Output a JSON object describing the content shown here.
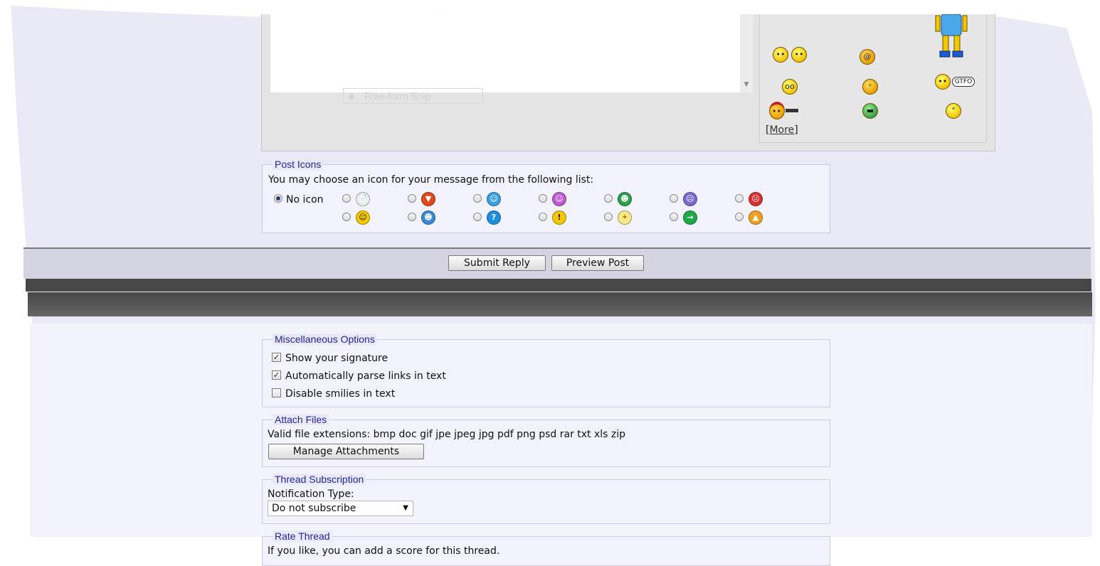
{
  "editor": {
    "snip_ghost_label": "Free-form Snip",
    "more_link": "More"
  },
  "smilies": [
    "tweedledum-icon",
    "dizzy-icon",
    "laughing-duo-icon",
    "eek-icon",
    "devil-icon",
    "gtfo-icon",
    "pirate-gun-icon",
    "grin-icon",
    "shocked-icon"
  ],
  "post_icons": {
    "legend": "Post Icons",
    "prompt": "You may choose an icon for your message from the following list:",
    "no_icon_label": "No icon",
    "row1": [
      {
        "name": "post-icon-document",
        "glyph": "📄",
        "color": "#f0f0f0",
        "fg": "#333"
      },
      {
        "name": "post-icon-thumbs-down",
        "glyph": "▼",
        "color": "#e0471a",
        "fg": "#fff"
      },
      {
        "name": "post-icon-wink",
        "glyph": "☺",
        "color": "#3aa0e0",
        "fg": "#fff"
      },
      {
        "name": "post-icon-tongue",
        "glyph": "☺",
        "color": "#c05ad0",
        "fg": "#fff"
      },
      {
        "name": "post-icon-big-grin",
        "glyph": "☻",
        "color": "#2fa04a",
        "fg": "#fff"
      },
      {
        "name": "post-icon-frown",
        "glyph": "☹",
        "color": "#7a6ad0",
        "fg": "#fff"
      },
      {
        "name": "post-icon-mad",
        "glyph": "☹",
        "color": "#d83030",
        "fg": "#fff"
      }
    ],
    "row2": [
      {
        "name": "post-icon-smile",
        "glyph": "☺",
        "color": "#f3c800",
        "fg": "#222"
      },
      {
        "name": "post-icon-cool",
        "glyph": "☻",
        "color": "#3a8ad8",
        "fg": "#fff"
      },
      {
        "name": "post-icon-question",
        "glyph": "?",
        "color": "#1e8fe0",
        "fg": "#fff"
      },
      {
        "name": "post-icon-exclamation",
        "glyph": "!",
        "color": "#f3c800",
        "fg": "#222"
      },
      {
        "name": "post-icon-lightbulb",
        "glyph": "✦",
        "color": "#f7e98a",
        "fg": "#aa8800"
      },
      {
        "name": "post-icon-arrow",
        "glyph": "→",
        "color": "#1fa84a",
        "fg": "#fff"
      },
      {
        "name": "post-icon-thumbs-up",
        "glyph": "▲",
        "color": "#f0a020",
        "fg": "#fff"
      }
    ]
  },
  "buttons": {
    "submit": "Submit Reply",
    "preview": "Preview Post"
  },
  "misc_options": {
    "legend": "Miscellaneous Options",
    "items": [
      {
        "label": "Show your signature",
        "checked": true
      },
      {
        "label": "Automatically parse links in text",
        "checked": true
      },
      {
        "label": "Disable smilies in text",
        "checked": false
      }
    ]
  },
  "attach": {
    "legend": "Attach Files",
    "extensions_text": "Valid file extensions: bmp doc gif jpe jpeg jpg pdf png psd rar txt xls zip",
    "manage_button": "Manage Attachments"
  },
  "subscription": {
    "legend": "Thread Subscription",
    "label": "Notification Type:",
    "selected": "Do not subscribe"
  },
  "rate": {
    "legend": "Rate Thread",
    "text": "If you like, you can add a score for this thread."
  }
}
